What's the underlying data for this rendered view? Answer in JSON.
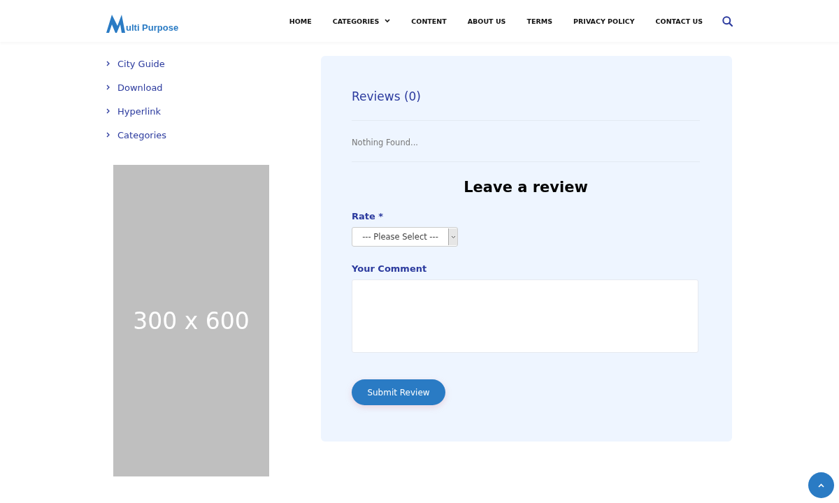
{
  "logo": {
    "text": "ulti Purpose"
  },
  "nav": [
    {
      "label": "HOME",
      "dropdown": false
    },
    {
      "label": "CATEGORIES",
      "dropdown": true
    },
    {
      "label": "CONTENT",
      "dropdown": false
    },
    {
      "label": "ABOUT US",
      "dropdown": false
    },
    {
      "label": "TERMS",
      "dropdown": false
    },
    {
      "label": "PRIVACY POLICY",
      "dropdown": false
    },
    {
      "label": "CONTACT US",
      "dropdown": false
    }
  ],
  "sidebar": {
    "items": [
      "City Guide",
      "Download",
      "Hyperlink",
      "Categories"
    ],
    "ad": {
      "text": "300 x 600"
    }
  },
  "reviews": {
    "title": "Reviews (0)",
    "empty_text": "Nothing Found..."
  },
  "form": {
    "heading": "Leave a review",
    "rate_label": "Rate *",
    "rate_select": "--- Please Select ---",
    "comment_label": "Your Comment",
    "submit": "Submit Review"
  }
}
